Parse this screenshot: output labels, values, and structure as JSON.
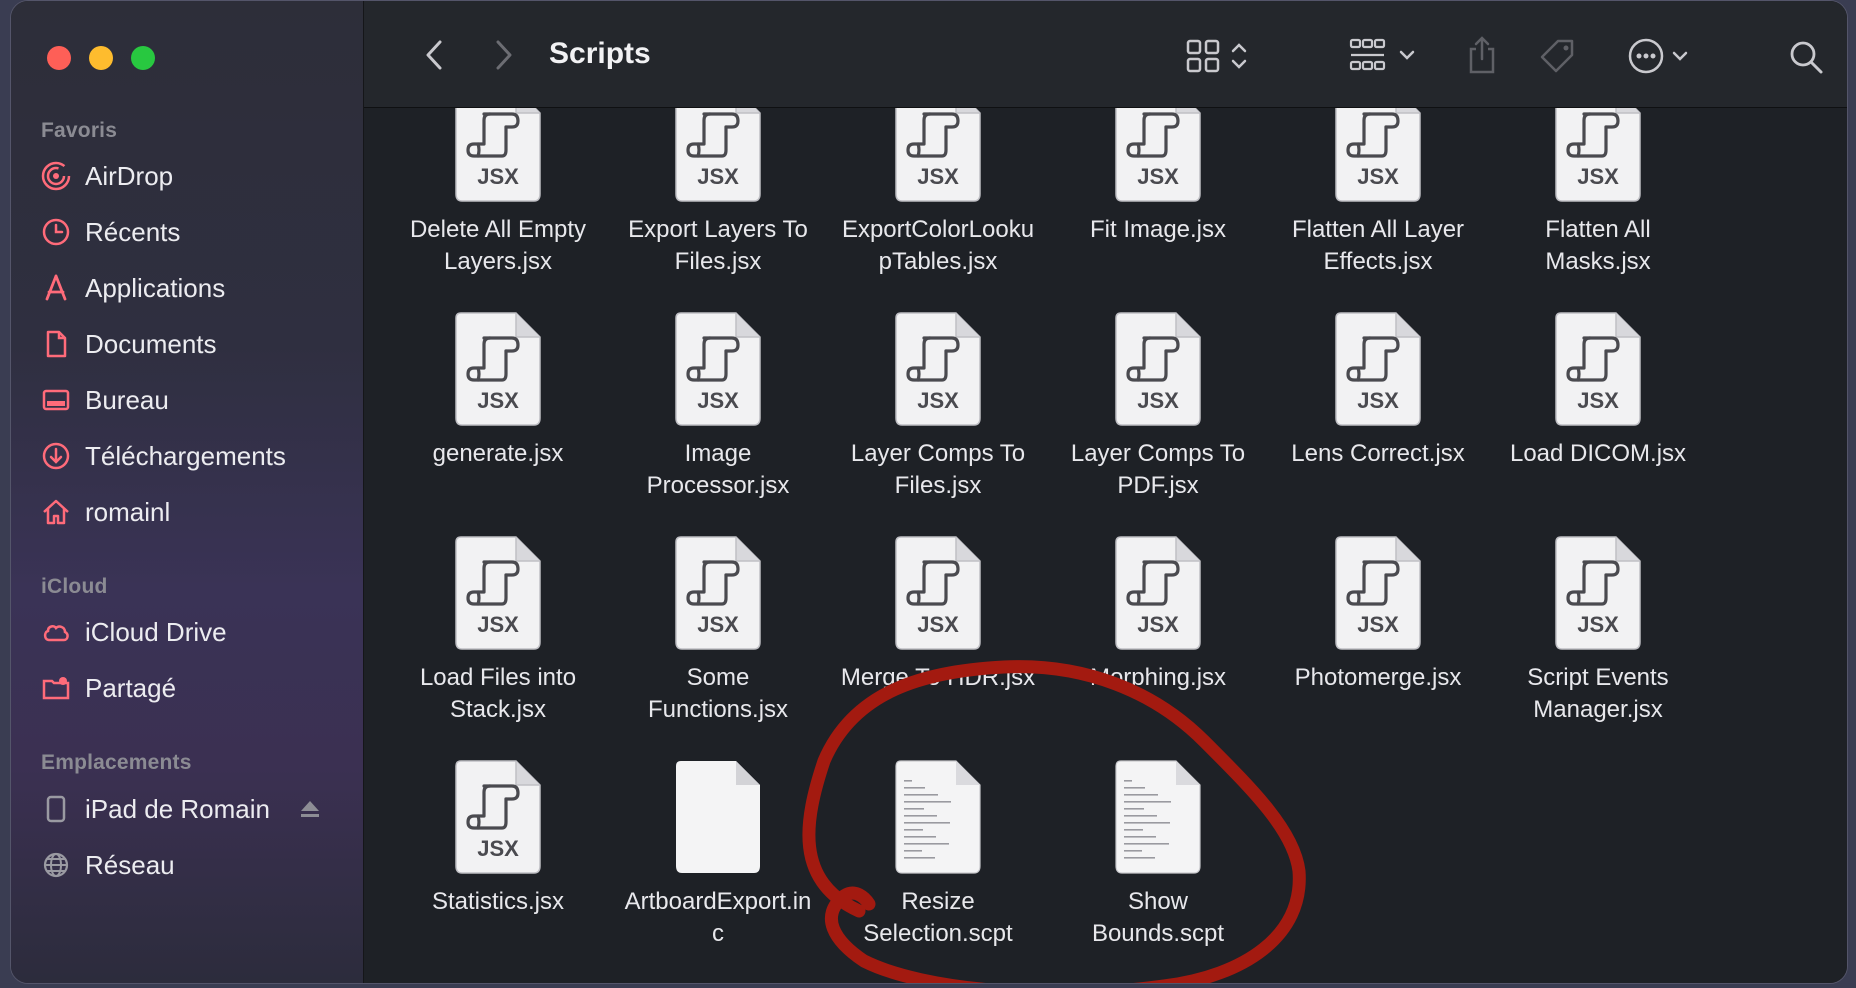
{
  "window": {
    "title": "Scripts"
  },
  "sidebar": {
    "sections": [
      {
        "label": "Favoris"
      },
      {
        "label": "iCloud"
      },
      {
        "label": "Emplacements"
      }
    ],
    "favorites": [
      {
        "label": "AirDrop",
        "icon": "airdrop-icon"
      },
      {
        "label": "Récents",
        "icon": "clock-icon"
      },
      {
        "label": "Applications",
        "icon": "applications-icon"
      },
      {
        "label": "Documents",
        "icon": "document-icon"
      },
      {
        "label": "Bureau",
        "icon": "desktop-icon"
      },
      {
        "label": "Téléchargements",
        "icon": "download-icon"
      },
      {
        "label": "romainl",
        "icon": "home-icon"
      }
    ],
    "icloud": [
      {
        "label": "iCloud Drive",
        "icon": "cloud-icon"
      },
      {
        "label": "Partagé",
        "icon": "shared-folder-icon"
      }
    ],
    "locations": [
      {
        "label": "iPad de Romain",
        "icon": "ipad-icon"
      },
      {
        "label": "Réseau",
        "icon": "network-icon"
      }
    ],
    "icon_color": "#ff6b7a"
  },
  "files": [
    {
      "name": "Delete All Empty Layers.jsx",
      "lines": [
        "Delete All Empty",
        "Layers.jsx"
      ],
      "kind": "jsx"
    },
    {
      "name": "Export Layers To Files.jsx",
      "lines": [
        "Export Layers To",
        "Files.jsx"
      ],
      "kind": "jsx"
    },
    {
      "name": "ExportColorLookupTables.jsx",
      "lines": [
        "ExportColorLooku",
        "pTables.jsx"
      ],
      "kind": "jsx"
    },
    {
      "name": "Fit Image.jsx",
      "lines": [
        "Fit Image.jsx"
      ],
      "kind": "jsx"
    },
    {
      "name": "Flatten All Layer Effects.jsx",
      "lines": [
        "Flatten All Layer",
        "Effects.jsx"
      ],
      "kind": "jsx"
    },
    {
      "name": "Flatten All Masks.jsx",
      "lines": [
        "Flatten All",
        "Masks.jsx"
      ],
      "kind": "jsx"
    },
    {
      "name": "generate.jsx",
      "lines": [
        "generate.jsx"
      ],
      "kind": "jsx"
    },
    {
      "name": "Image Processor.jsx",
      "lines": [
        "Image",
        "Processor.jsx"
      ],
      "kind": "jsx"
    },
    {
      "name": "Layer Comps To Files.jsx",
      "lines": [
        "Layer Comps To",
        "Files.jsx"
      ],
      "kind": "jsx"
    },
    {
      "name": "Layer Comps To PDF.jsx",
      "lines": [
        "Layer Comps To",
        "PDF.jsx"
      ],
      "kind": "jsx"
    },
    {
      "name": "Lens Correct.jsx",
      "lines": [
        "Lens Correct.jsx"
      ],
      "kind": "jsx"
    },
    {
      "name": "Load DICOM.jsx",
      "lines": [
        "Load DICOM.jsx"
      ],
      "kind": "jsx"
    },
    {
      "name": "Load Files into Stack.jsx",
      "lines": [
        "Load Files into",
        "Stack.jsx"
      ],
      "kind": "jsx"
    },
    {
      "name": "Some Functions.jsx",
      "lines": [
        "Some",
        "Functions.jsx"
      ],
      "kind": "jsx"
    },
    {
      "name": "Merge To HDR.jsx",
      "lines": [
        "Merge To HDR.jsx"
      ],
      "kind": "jsx"
    },
    {
      "name": "Morphing.jsx",
      "lines": [
        "Morphing.jsx"
      ],
      "kind": "jsx"
    },
    {
      "name": "Photomerge.jsx",
      "lines": [
        "Photomerge.jsx"
      ],
      "kind": "jsx"
    },
    {
      "name": "Script Events Manager.jsx",
      "lines": [
        "Script Events",
        "Manager.jsx"
      ],
      "kind": "jsx"
    },
    {
      "name": "Statistics.jsx",
      "lines": [
        "Statistics.jsx"
      ],
      "kind": "jsx"
    },
    {
      "name": "ArtboardExport.inc",
      "lines": [
        "ArtboardExport.in",
        "c"
      ],
      "kind": "blank"
    },
    {
      "name": "Resize Selection.scpt",
      "lines": [
        "Resize",
        "Selection.scpt"
      ],
      "kind": "scpt"
    },
    {
      "name": "Show Bounds.scpt",
      "lines": [
        "Show",
        "Bounds.scpt"
      ],
      "kind": "scpt"
    }
  ],
  "jsx_badge": "JSX",
  "annotation": {
    "color": "#a31a10",
    "shape": "hand-drawn-circle"
  }
}
